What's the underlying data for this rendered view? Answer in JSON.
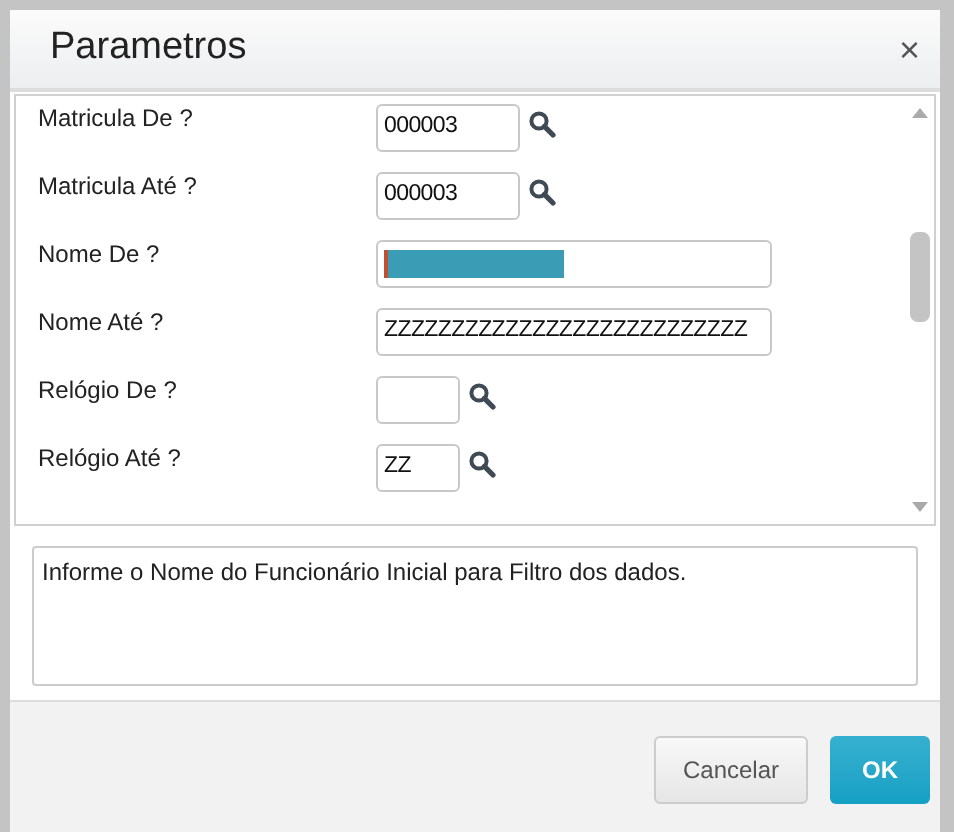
{
  "dialog": {
    "title": "Parametros",
    "close": "×"
  },
  "parameters": [
    {
      "label": "Matricula De ?",
      "kind": "code-lookup",
      "value": "000003"
    },
    {
      "label": "Matricula Até ?",
      "kind": "code-lookup",
      "value": "000003"
    },
    {
      "label": "Nome De ?",
      "kind": "text",
      "focused": true
    },
    {
      "label": "Nome Até ?",
      "kind": "text",
      "value": "ZZZZZZZZZZZZZZZZZZZZZZZZZZZ"
    },
    {
      "label": "Relógio De ?",
      "kind": "short-lookup"
    },
    {
      "label": "Relógio Até ?",
      "kind": "short-lookup",
      "value": "ZZ"
    }
  ],
  "help_text": "Informe o Nome do Funcionário Inicial para Filtro dos dados.",
  "buttons": [
    {
      "label": "Cancelar",
      "kind": "secondary"
    },
    {
      "label": "OK",
      "kind": "primary"
    }
  ]
}
